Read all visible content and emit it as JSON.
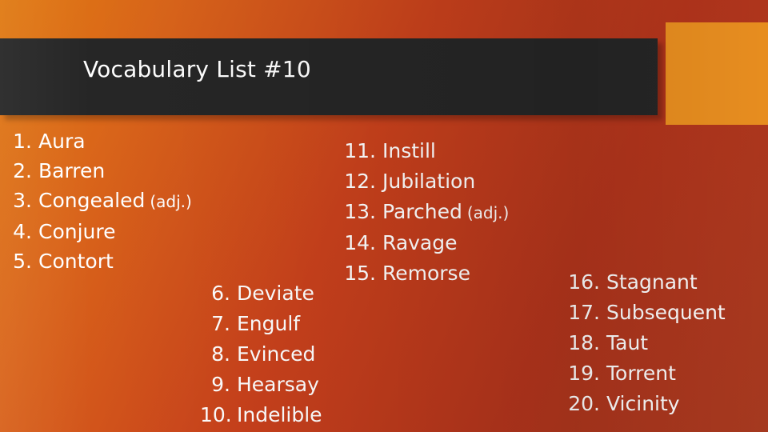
{
  "slide": {
    "title": "Vocabulary List #10",
    "background_colors": {
      "gradient_start": "#e07a12",
      "gradient_end": "#a83a20",
      "title_bar": "#262626",
      "accent_block": "#ec9020",
      "text": "#ffffff"
    },
    "columns": [
      {
        "name": "column-1",
        "items": [
          {
            "number": "1.",
            "word": "Aura",
            "pos": ""
          },
          {
            "number": "2.",
            "word": "Barren",
            "pos": ""
          },
          {
            "number": "3.",
            "word": "Congealed",
            "pos": "(adj.)"
          },
          {
            "number": "4.",
            "word": "Conjure",
            "pos": ""
          },
          {
            "number": "5.",
            "word": "Contort",
            "pos": ""
          }
        ]
      },
      {
        "name": "column-2",
        "items": [
          {
            "number": "6.",
            "word": "Deviate",
            "pos": ""
          },
          {
            "number": "7.",
            "word": "Engulf",
            "pos": ""
          },
          {
            "number": "8.",
            "word": "Evinced",
            "pos": ""
          },
          {
            "number": "9.",
            "word": "Hearsay",
            "pos": ""
          },
          {
            "number": "10.",
            "word": "Indelible",
            "pos": ""
          }
        ]
      },
      {
        "name": "column-3",
        "items": [
          {
            "number": "11.",
            "word": "Instill",
            "pos": ""
          },
          {
            "number": "12.",
            "word": "Jubilation",
            "pos": ""
          },
          {
            "number": "13.",
            "word": "Parched",
            "pos": "(adj.)"
          },
          {
            "number": "14.",
            "word": "Ravage",
            "pos": ""
          },
          {
            "number": "15.",
            "word": "Remorse",
            "pos": ""
          }
        ]
      },
      {
        "name": "column-4",
        "items": [
          {
            "number": "16.",
            "word": "Stagnant",
            "pos": ""
          },
          {
            "number": "17.",
            "word": "Subsequent",
            "pos": ""
          },
          {
            "number": "18.",
            "word": "Taut",
            "pos": ""
          },
          {
            "number": "19.",
            "word": "Torrent",
            "pos": ""
          },
          {
            "number": "20.",
            "word": "Vicinity",
            "pos": ""
          }
        ]
      }
    ]
  }
}
